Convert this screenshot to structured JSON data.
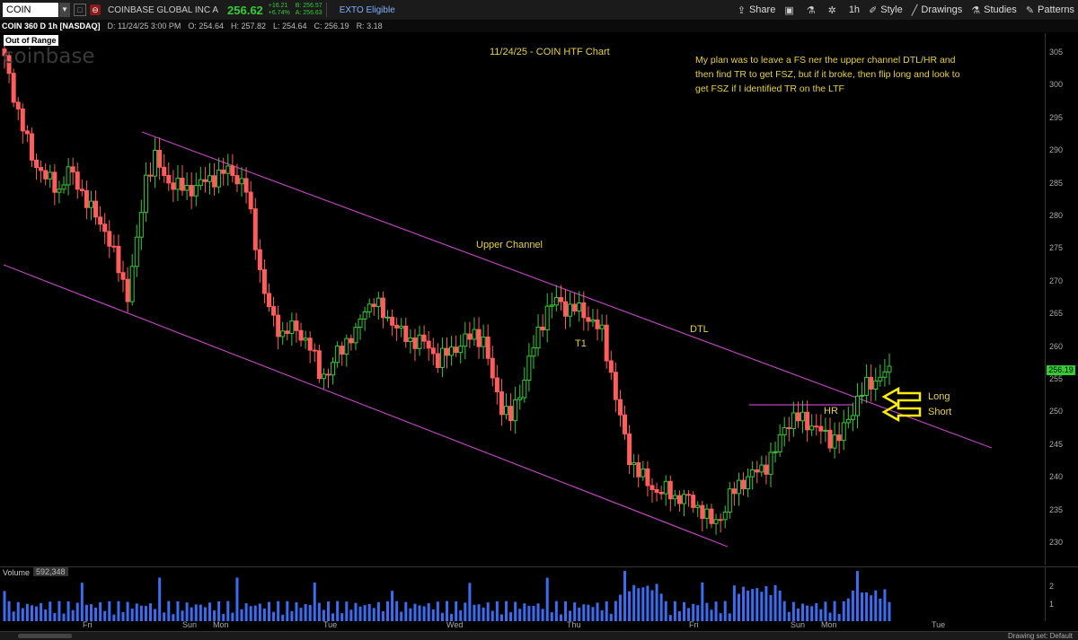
{
  "toolbar": {
    "symbol": "COIN",
    "company": "COINBASE GLOBAL INC A",
    "last_price": "256.62",
    "change": "+16.21",
    "change_pct": "+6.74%",
    "bid": "B: 256.57",
    "ask": "A: 256.63",
    "exto": "EXTO Eligible",
    "share": "Share",
    "timeframe": "1h",
    "style": "Style",
    "drawings": "Drawings",
    "studies": "Studies",
    "patterns": "Patterns"
  },
  "ohlc_bar": {
    "title": "COIN 360 D 1h [NASDAQ]",
    "date": "D: 11/24/25 3:00 PM",
    "open": "O: 254.64",
    "high": "H: 257.82",
    "low": "L: 254.64",
    "close": "C: 256.19",
    "range": "R: 3.18"
  },
  "chart": {
    "out_of_range": "Out of Range",
    "logo": "coinbase",
    "title": "11/24/25 - COIN HTF Chart",
    "plan": "My plan was to leave a FS ner the upper channel DTL/HR and then find TR to get FSZ, but if it broke, then flip long and look to get FSZ if I identified TR on the LTF",
    "annotations": {
      "upper_channel": "Upper Channel",
      "dtl": "DTL",
      "t1": "T1",
      "hr": "HR",
      "long": "Long",
      "short": "Short"
    },
    "current_price_tag": "256.19",
    "colors": {
      "up": "#33cc33",
      "down": "#ff5c5c",
      "channel": "#c040c0",
      "annotation": "#e8d235",
      "arrow": "#ffee00"
    }
  },
  "chart_data": {
    "type": "candlestick",
    "y_ticks": [
      "305",
      "300",
      "295",
      "290",
      "285",
      "280",
      "275",
      "270",
      "265",
      "260",
      "255",
      "250",
      "245",
      "240",
      "235",
      "230"
    ],
    "ylim": [
      228,
      307
    ],
    "x_ticks": [
      "Fri",
      "Sun",
      "Mon",
      "Tue",
      "Wed",
      "Thu",
      "Fri",
      "Sun",
      "Mon",
      "Tue"
    ],
    "path": [
      [
        0,
        304
      ],
      [
        3,
        296
      ],
      [
        6,
        289
      ],
      [
        9,
        286
      ],
      [
        12,
        284
      ],
      [
        14,
        287
      ],
      [
        16,
        285
      ],
      [
        19,
        281
      ],
      [
        22,
        278
      ],
      [
        25,
        272
      ],
      [
        27,
        268
      ],
      [
        29,
        276
      ],
      [
        31,
        286
      ],
      [
        33,
        289
      ],
      [
        35,
        286
      ],
      [
        37,
        285
      ],
      [
        40,
        284
      ],
      [
        43,
        285
      ],
      [
        46,
        286
      ],
      [
        49,
        287
      ],
      [
        51,
        286
      ],
      [
        53,
        284
      ],
      [
        55,
        276
      ],
      [
        57,
        268
      ],
      [
        59,
        264
      ],
      [
        61,
        262
      ],
      [
        63,
        263
      ],
      [
        65,
        262
      ],
      [
        67,
        260
      ],
      [
        69,
        256
      ],
      [
        71,
        256
      ],
      [
        73,
        259
      ],
      [
        75,
        261
      ],
      [
        77,
        262
      ],
      [
        79,
        266
      ],
      [
        81,
        267
      ],
      [
        83,
        265
      ],
      [
        85,
        264
      ],
      [
        87,
        262
      ],
      [
        89,
        261
      ],
      [
        91,
        261
      ],
      [
        93,
        260
      ],
      [
        95,
        258
      ],
      [
        97,
        259
      ],
      [
        99,
        260
      ],
      [
        101,
        261
      ],
      [
        103,
        262
      ],
      [
        105,
        261
      ],
      [
        107,
        255
      ],
      [
        109,
        251
      ],
      [
        111,
        249
      ],
      [
        113,
        253
      ],
      [
        115,
        258
      ],
      [
        117,
        262
      ],
      [
        119,
        266
      ],
      [
        121,
        267
      ],
      [
        123,
        266
      ],
      [
        125,
        266
      ],
      [
        127,
        265
      ],
      [
        129,
        264
      ],
      [
        131,
        262
      ],
      [
        133,
        256
      ],
      [
        135,
        249
      ],
      [
        137,
        243
      ],
      [
        139,
        241
      ],
      [
        141,
        239
      ],
      [
        143,
        238
      ],
      [
        145,
        238
      ],
      [
        147,
        237
      ],
      [
        149,
        237
      ],
      [
        151,
        236
      ],
      [
        153,
        235
      ],
      [
        155,
        233
      ],
      [
        157,
        234
      ],
      [
        159,
        237
      ],
      [
        161,
        239
      ],
      [
        163,
        240
      ],
      [
        165,
        241
      ],
      [
        167,
        242
      ],
      [
        169,
        244
      ],
      [
        171,
        248
      ],
      [
        173,
        249
      ],
      [
        175,
        249
      ],
      [
        177,
        248
      ],
      [
        179,
        247
      ],
      [
        181,
        246
      ],
      [
        183,
        246
      ],
      [
        185,
        249
      ],
      [
        187,
        252
      ],
      [
        189,
        254
      ],
      [
        191,
        255
      ],
      [
        193,
        256
      ]
    ],
    "volume_ylim": [
      0,
      2.5
    ],
    "volume_ticks": [
      "2",
      "1"
    ],
    "volume_label": "Volume",
    "volume_value": "592,348"
  },
  "volume": {
    "label": "Volume",
    "value": "592,348"
  },
  "bottom": {
    "drawing_set": "Drawing set: Default"
  }
}
